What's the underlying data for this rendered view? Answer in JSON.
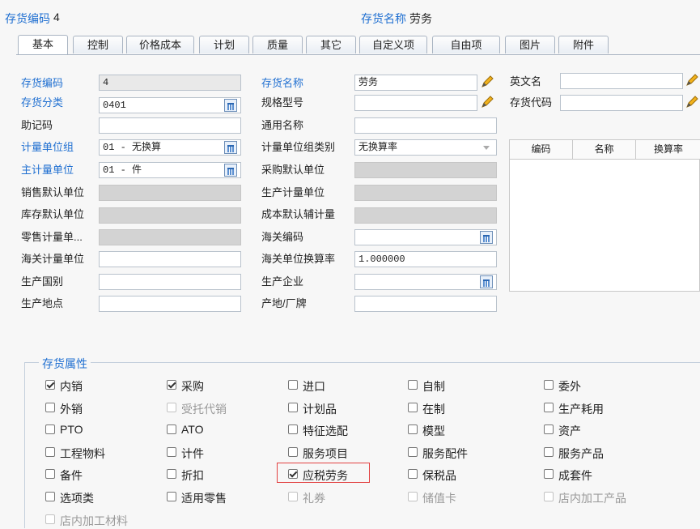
{
  "header": {
    "code_label": "存货编码",
    "code_value": "4",
    "name_label": "存货名称",
    "name_value": "劳务"
  },
  "tabs": [
    "基本",
    "控制",
    "价格成本",
    "计划",
    "质量",
    "其它",
    "自定义项",
    "自由项",
    "图片",
    "附件"
  ],
  "active_tab": "基本",
  "form": {
    "inv_code": {
      "label": "存货编码",
      "value": "4"
    },
    "inv_class": {
      "label": "存货分类",
      "value": "0401"
    },
    "mnemonic": {
      "label": "助记码",
      "value": ""
    },
    "uom_group": {
      "label": "计量单位组",
      "value": "01 - 无换算"
    },
    "main_uom": {
      "label": "主计量单位",
      "value": "01 - 件"
    },
    "sales_uom": {
      "label": "销售默认单位",
      "value": ""
    },
    "stock_uom": {
      "label": "库存默认单位",
      "value": ""
    },
    "retail_uom": {
      "label": "零售计量单...",
      "value": ""
    },
    "customs_uom": {
      "label": "海关计量单位",
      "value": ""
    },
    "origin_country": {
      "label": "生产国别",
      "value": ""
    },
    "origin_place": {
      "label": "生产地点",
      "value": ""
    },
    "inv_name": {
      "label": "存货名称",
      "value": "劳务"
    },
    "spec": {
      "label": "规格型号",
      "value": ""
    },
    "common_name": {
      "label": "通用名称",
      "value": ""
    },
    "uom_group_type": {
      "label": "计量单位组类别",
      "value": "无换算率"
    },
    "purchase_uom": {
      "label": "采购默认单位",
      "value": ""
    },
    "prod_uom": {
      "label": "生产计量单位",
      "value": ""
    },
    "cost_aux_uom": {
      "label": "成本默认辅计量",
      "value": ""
    },
    "customs_code": {
      "label": "海关编码",
      "value": ""
    },
    "customs_rate": {
      "label": "海关单位换算率",
      "value": "1.000000"
    },
    "producer": {
      "label": "生产企业",
      "value": ""
    },
    "brand": {
      "label": "产地/厂牌",
      "value": ""
    },
    "english_name": {
      "label": "英文名",
      "value": ""
    },
    "inv_alias": {
      "label": "存货代码",
      "value": ""
    }
  },
  "grid": {
    "columns": [
      "编码",
      "名称",
      "换算率"
    ]
  },
  "attributes": {
    "title": "存货属性",
    "items": [
      {
        "label": "内销",
        "checked": true,
        "disabled": false
      },
      {
        "label": "采购",
        "checked": true,
        "disabled": false
      },
      {
        "label": "进口",
        "checked": false,
        "disabled": false
      },
      {
        "label": "自制",
        "checked": false,
        "disabled": false
      },
      {
        "label": "委外",
        "checked": false,
        "disabled": false
      },
      {
        "label": "外销",
        "checked": false,
        "disabled": false
      },
      {
        "label": "受托代销",
        "checked": false,
        "disabled": true
      },
      {
        "label": "计划品",
        "checked": false,
        "disabled": false
      },
      {
        "label": "在制",
        "checked": false,
        "disabled": false
      },
      {
        "label": "生产耗用",
        "checked": false,
        "disabled": false
      },
      {
        "label": "PTO",
        "checked": false,
        "disabled": false
      },
      {
        "label": "ATO",
        "checked": false,
        "disabled": false
      },
      {
        "label": "特征选配",
        "checked": false,
        "disabled": false
      },
      {
        "label": "模型",
        "checked": false,
        "disabled": false
      },
      {
        "label": "资产",
        "checked": false,
        "disabled": false
      },
      {
        "label": "工程物料",
        "checked": false,
        "disabled": false
      },
      {
        "label": "计件",
        "checked": false,
        "disabled": false
      },
      {
        "label": "服务项目",
        "checked": false,
        "disabled": false
      },
      {
        "label": "服务配件",
        "checked": false,
        "disabled": false
      },
      {
        "label": "服务产品",
        "checked": false,
        "disabled": false
      },
      {
        "label": "备件",
        "checked": false,
        "disabled": false
      },
      {
        "label": "折扣",
        "checked": false,
        "disabled": false
      },
      {
        "label": "应税劳务",
        "checked": true,
        "disabled": false
      },
      {
        "label": "保税品",
        "checked": false,
        "disabled": false
      },
      {
        "label": "成套件",
        "checked": false,
        "disabled": false
      },
      {
        "label": "选项类",
        "checked": false,
        "disabled": false
      },
      {
        "label": "适用零售",
        "checked": false,
        "disabled": false
      },
      {
        "label": "礼券",
        "checked": false,
        "disabled": true
      },
      {
        "label": "储值卡",
        "checked": false,
        "disabled": true
      },
      {
        "label": "店内加工产品",
        "checked": false,
        "disabled": true
      },
      {
        "label": "店内加工材料",
        "checked": false,
        "disabled": true
      }
    ]
  },
  "colors": {
    "accent": "#1f6fd1",
    "highlight": "#e24141",
    "disabled_field": "#d3d3d3"
  }
}
